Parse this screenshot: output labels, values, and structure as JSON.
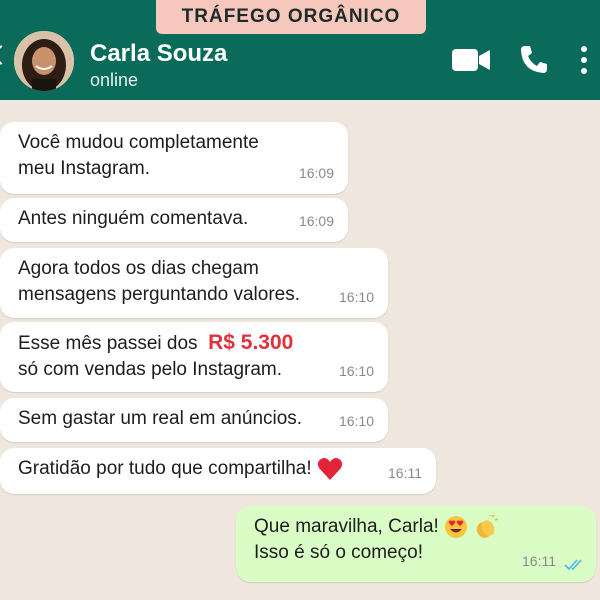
{
  "banner": {
    "text": "TRÁFEGO ORGÂNICO"
  },
  "header": {
    "contact_name": "Carla Souza",
    "status": "online"
  },
  "icons": {
    "back": "back-arrow-icon",
    "video": "video-call-icon",
    "phone": "phone-call-icon",
    "menu": "more-options-icon"
  },
  "colors": {
    "header_bg": "#0b6b5a",
    "banner_bg": "#f5c7bd",
    "chat_bg": "#efe7dd",
    "incoming_bubble": "#ffffff",
    "outgoing_bubble": "#d9fdc4",
    "highlight": "#e0323a",
    "read_ticks": "#4fb6ec"
  },
  "messages": [
    {
      "direction": "in",
      "lines": [
        "Você mudou completamente",
        "meu Instagram."
      ],
      "time": "16:09"
    },
    {
      "direction": "in",
      "lines": [
        "Antes ninguém comentava."
      ],
      "time": "16:09"
    },
    {
      "direction": "in",
      "lines": [
        "Agora todos os dias chegam",
        "mensagens perguntando valores."
      ],
      "time": "16:10"
    },
    {
      "direction": "in",
      "line1_prefix": "Esse mês passei dos",
      "highlight": "R$ 5.300",
      "line2": "só com vendas pelo Instagram.",
      "time": "16:10"
    },
    {
      "direction": "in",
      "lines": [
        "Sem gastar um real em anúncios."
      ],
      "time": "16:10"
    },
    {
      "direction": "in",
      "lines": [
        "Gratidão por tudo que compartilha!"
      ],
      "emoji": "red-heart",
      "time": "16:11"
    },
    {
      "direction": "out",
      "line1": "Que maravilha, Carla!",
      "emojis": [
        "heart-eyes",
        "clapping-hands"
      ],
      "line2": "Isso é só o começo!",
      "time": "16:11",
      "status": "read"
    }
  ]
}
